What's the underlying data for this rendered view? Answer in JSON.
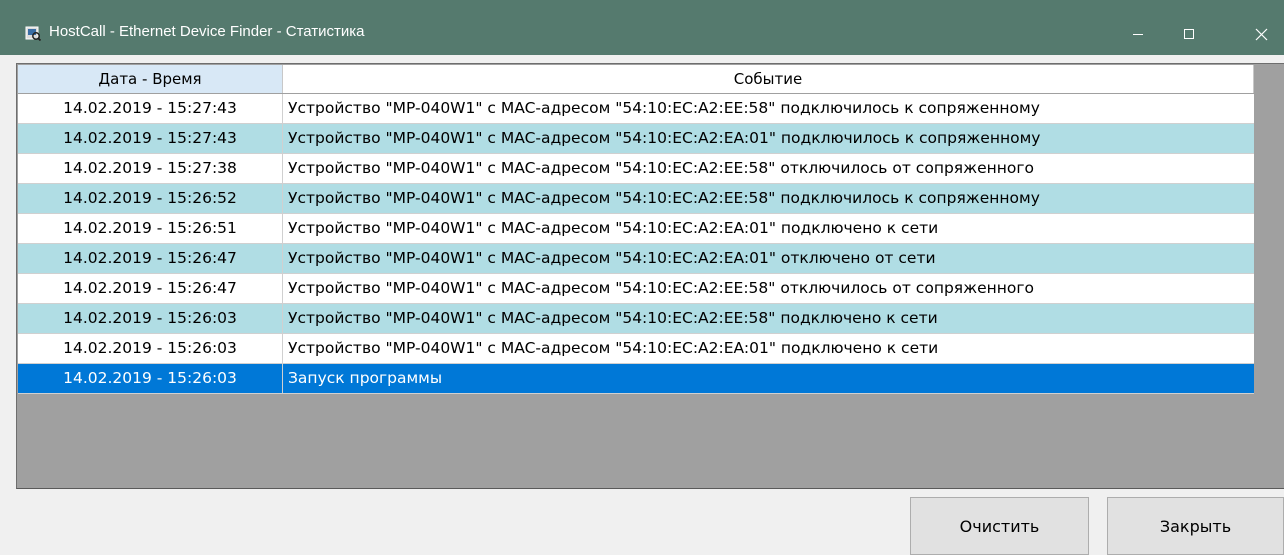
{
  "window": {
    "title": "HostCall - Ethernet Device Finder - Статистика",
    "titlebar_color": "#557a6e"
  },
  "grid": {
    "columns": [
      "Дата - Время",
      "Событие"
    ],
    "rows": [
      {
        "datetime": "14.02.2019 - 15:27:43",
        "event": "Устройство \"MP-040W1\" с MAC-адресом \"54:10:EC:A2:EE:58\" подключилось к сопряженному",
        "selected": false
      },
      {
        "datetime": "14.02.2019 - 15:27:43",
        "event": "Устройство \"MP-040W1\" с MAC-адресом \"54:10:EC:A2:EA:01\" подключилось к сопряженному",
        "selected": false
      },
      {
        "datetime": "14.02.2019 - 15:27:38",
        "event": "Устройство \"MP-040W1\" с MAC-адресом \"54:10:EC:A2:EE:58\" отключилось от сопряженного",
        "selected": false
      },
      {
        "datetime": "14.02.2019 - 15:26:52",
        "event": "Устройство \"MP-040W1\" с MAC-адресом \"54:10:EC:A2:EE:58\" подключилось к сопряженному",
        "selected": false
      },
      {
        "datetime": "14.02.2019 - 15:26:51",
        "event": "Устройство \"MP-040W1\" с MAC-адресом \"54:10:EC:A2:EA:01\" подключено к сети",
        "selected": false
      },
      {
        "datetime": "14.02.2019 - 15:26:47",
        "event": "Устройство \"MP-040W1\" с MAC-адресом \"54:10:EC:A2:EA:01\" отключено от сети",
        "selected": false
      },
      {
        "datetime": "14.02.2019 - 15:26:47",
        "event": "Устройство \"MP-040W1\" с MAC-адресом \"54:10:EC:A2:EE:58\" отключилось от сопряженного",
        "selected": false
      },
      {
        "datetime": "14.02.2019 - 15:26:03",
        "event": "Устройство \"MP-040W1\" с MAC-адресом \"54:10:EC:A2:EE:58\" подключено к сети",
        "selected": false
      },
      {
        "datetime": "14.02.2019 - 15:26:03",
        "event": "Устройство \"MP-040W1\" с MAC-адресом \"54:10:EC:A2:EA:01\" подключено к сети",
        "selected": false
      },
      {
        "datetime": "14.02.2019 - 15:26:03",
        "event": "Запуск программы",
        "selected": true
      }
    ],
    "alt_row_color": "#b0dde4",
    "selected_row_color": "#0078d7"
  },
  "buttons": {
    "clear_label": "Очистить",
    "close_label": "Закрыть"
  }
}
